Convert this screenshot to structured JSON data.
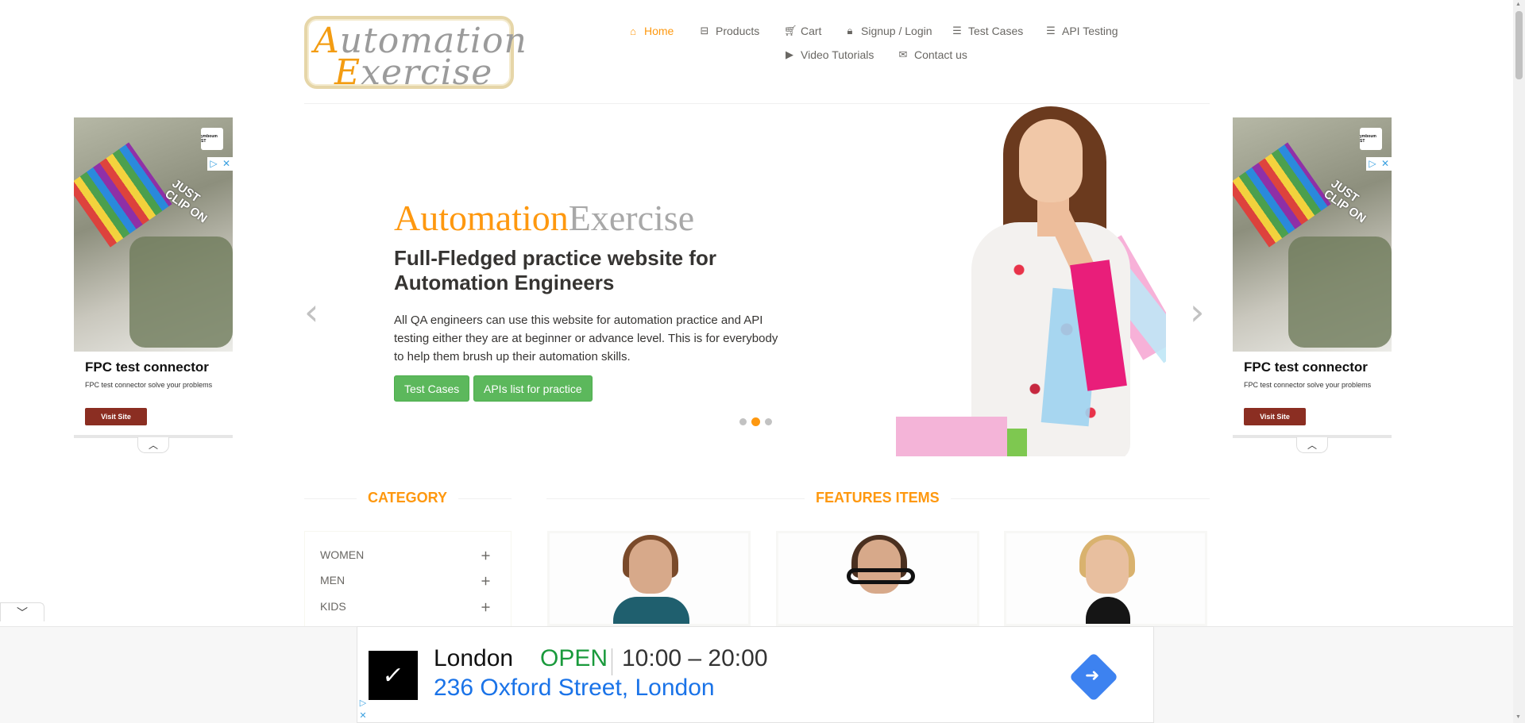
{
  "header": {
    "logo_part1_cap": "A",
    "logo_part1_rest": "utomation",
    "logo_part2_cap": "E",
    "logo_part2_rest": "xercise",
    "nav": [
      {
        "label": "Home",
        "icon": "home-icon",
        "active": true
      },
      {
        "label": "Products",
        "icon": "products-icon"
      },
      {
        "label": "Cart",
        "icon": "cart-icon"
      },
      {
        "label": "Signup / Login",
        "icon": "lock-icon"
      },
      {
        "label": "Test Cases",
        "icon": "list-icon"
      },
      {
        "label": "API Testing",
        "icon": "list-icon"
      },
      {
        "label": "Video Tutorials",
        "icon": "youtube-icon"
      },
      {
        "label": "Contact us",
        "icon": "envelope-icon"
      }
    ]
  },
  "slider": {
    "title_a": "Automation",
    "title_b": "Exercise",
    "subtitle": "Full-Fledged practice website for Automation Engineers",
    "description": "All QA engineers can use this website for automation practice and API testing either they are at beginner or advance level. This is for everybody to help them brush up their automation skills.",
    "btn_test_cases": "Test Cases",
    "btn_apis": "APIs list for practice",
    "active_slide": 2,
    "slide_count": 3
  },
  "side_ad": {
    "slogan_line1": "JUST",
    "slogan_line2": "CLIP ON",
    "brand": "ymboum ST",
    "title": "FPC test connector",
    "description": "FPC test connector solve your problems",
    "button": "Visit Site"
  },
  "category": {
    "title": "CATEGORY",
    "items": [
      "WOMEN",
      "MEN",
      "KIDS"
    ]
  },
  "features": {
    "title": "FEATURES ITEMS"
  },
  "bottom_ad": {
    "logo": "✓",
    "city": "London",
    "status": "OPEN",
    "hours": "10:00 – 20:00",
    "address": "236 Oxford Street, London"
  },
  "colors": {
    "accent": "#FE980F",
    "button_green": "#5cb85c",
    "open_green": "#1a9a3c",
    "link_blue": "#1a73e8"
  }
}
